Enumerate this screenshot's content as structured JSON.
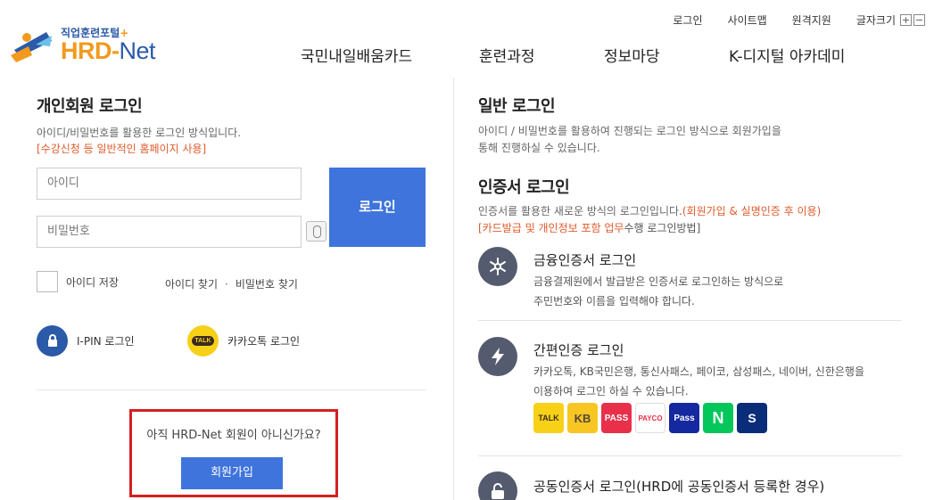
{
  "header": {
    "util_links": [
      "로그인",
      "사이트맵",
      "원격지원"
    ],
    "font_size_label": "글자크기",
    "font_plus": "+",
    "font_minus": "−",
    "logo_sub": "직업훈련포털",
    "logo_plus": "+",
    "logo_hrd": "HRD",
    "logo_dash": "-",
    "logo_net": "Net",
    "nav": [
      "국민내일배움카드",
      "훈련과정",
      "정보마당",
      "K-디지털 아카데미"
    ]
  },
  "personal_login": {
    "title": "개인회원 로그인",
    "desc": "아이디/비밀번호를 활용한 로그인 방식입니다.",
    "note": "[수강신청 등 일반적인 홈페이지 사용]",
    "id_placeholder": "아이디",
    "pw_placeholder": "비밀번호",
    "login_button": "로그인",
    "remember_label": "아이디 저장",
    "find_id": "아이디 찾기",
    "find_sep": "·",
    "find_pw": "비밀번호 찾기",
    "ipin_label": "I-PIN 로그인",
    "kakao_label": "카카오톡 로그인",
    "kakao_icon_text": "TALK"
  },
  "join": {
    "question": "아직 HRD-Net 회원이 아니신가요?",
    "button": "회원가입"
  },
  "general_login": {
    "title": "일반 로그인",
    "desc_line1": "아이디 / 비밀번호를 활용하여 진행되는 로그인 방식으로 회원가입을",
    "desc_line2": "통해 진행하실 수 있습니다."
  },
  "cert_login": {
    "title": "인증서 로그인",
    "desc_prefix": "인증서를 활용한 새로운 방식의 로그인입니다.",
    "desc_orange": "(회원가입 & 실명인증 후 이용)",
    "note_orange": "[카드발급 및 개인정보 포함 업무",
    "note_rest": "수행 로그인방법]",
    "items": [
      {
        "title": "금융인증서 로그인",
        "line1": "금융결제원에서 발급받은 인증서로 로그인하는 방식으로",
        "line2": "주민번호와 이름을 입력해야 합니다."
      },
      {
        "title": "간편인증 로그인",
        "line1": "카카오톡, KB국민은행, 통신사패스, 페이코, 삼성패스, 네이버, 신한은행을",
        "line2": "이용하여 로그인 하실 수 있습니다."
      },
      {
        "title": "공동인증서 로그인(HRD에 공동인증서 등록한 경우)"
      }
    ],
    "apps": [
      "TALK",
      "KB",
      "PASS",
      "PAYCO",
      "Pass",
      "N",
      "S"
    ]
  },
  "colors": {
    "primary_button": "#3f74dc",
    "accent_orange": "#e05a2a",
    "highlight_border": "#d42020",
    "icon_circle": "#545b6e"
  }
}
